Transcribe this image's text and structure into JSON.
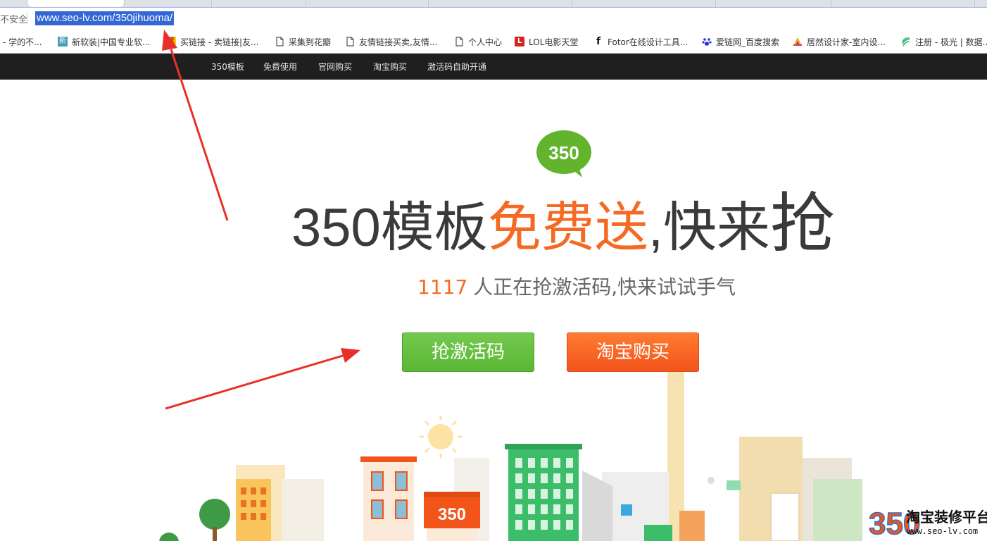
{
  "browser": {
    "security_label": "不安全",
    "url": "www.seo-lv.com/350jihuoma/"
  },
  "bookmarks": [
    {
      "label": "- 学的不...",
      "icon": "none"
    },
    {
      "label": "新软装|中国专业软...",
      "icon": "site-favicon-xin"
    },
    {
      "label": "买链接 - 卖链接|友...",
      "icon": "site-favicon-lian"
    },
    {
      "label": "采集到花瓣",
      "icon": "page-icon"
    },
    {
      "label": "友情链接买卖,友情...",
      "icon": "page-icon"
    },
    {
      "label": "个人中心",
      "icon": "page-icon"
    },
    {
      "label": "LOL电影天堂",
      "icon": "lol-favicon"
    },
    {
      "label": "Fotor在线设计工具...",
      "icon": "fotor-favicon"
    },
    {
      "label": "爱链网_百度搜索",
      "icon": "baidu-paw-icon"
    },
    {
      "label": "居然设计家-室内设...",
      "icon": "colorful-favicon"
    },
    {
      "label": "注册 - 极光 | 数据...",
      "icon": "jiguang-favicon"
    }
  ],
  "site_nav": [
    "350模板",
    "免费使用",
    "官网购买",
    "淘宝购买",
    "激活码自助开通"
  ],
  "hero": {
    "bubble_text": "350",
    "headline_part1": "350模板",
    "headline_part2": "免费送",
    "headline_part3": ",快来",
    "headline_part4": "抢",
    "sub_count": "1117",
    "sub_text": "人正在抢激活码,快来试试手气",
    "btn_primary": "抢激活码",
    "btn_secondary": "淘宝购买",
    "building_sign": "350"
  },
  "watermark": {
    "logo_text": "350",
    "title": "淘宝装修平台",
    "url": "www.seo-lv.com"
  },
  "colors": {
    "accent_orange": "#f56a23",
    "button_green": "#5bb635",
    "nav_bg": "#1f1f1f",
    "annotation_red": "#e8302b"
  }
}
